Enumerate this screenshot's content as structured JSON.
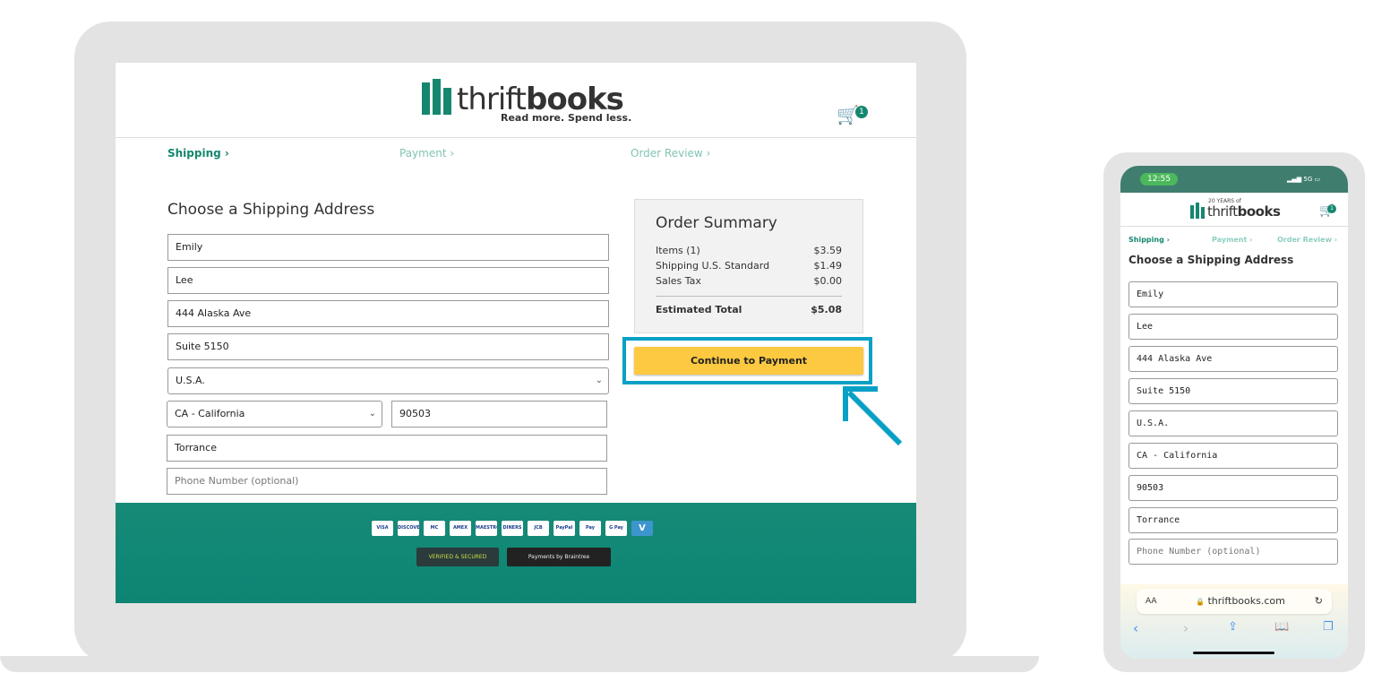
{
  "desktop": {
    "logo": {
      "word_light": "thrift",
      "word_bold": "books",
      "tagline": "Read more. Spend less."
    },
    "cart": {
      "icon": "cart-icon",
      "count": "1"
    },
    "steps": [
      {
        "label": "Shipping ›",
        "active": true
      },
      {
        "label": "Payment ›",
        "active": false
      },
      {
        "label": "Order Review ›",
        "active": false
      }
    ],
    "form": {
      "title": "Choose a Shipping Address",
      "first_name": "Emily",
      "last_name": "Lee",
      "address1": "444 Alaska Ave",
      "address2": "Suite 5150",
      "country": "U.S.A.",
      "state": "CA - California",
      "zip": "90503",
      "city": "Torrance",
      "phone_placeholder": "Phone Number (optional)"
    },
    "summary": {
      "title": "Order Summary",
      "rows": [
        {
          "label": "Items (1)",
          "value": "$3.59"
        },
        {
          "label": "Shipping U.S. Standard",
          "value": "$1.49"
        },
        {
          "label": "Sales Tax",
          "value": "$0.00"
        }
      ],
      "total_label": "Estimated Total",
      "total_value": "$5.08"
    },
    "continue_button": "Continue to Payment",
    "payment_cards": [
      "VISA",
      "DISCOVER",
      "MC",
      "AMEX",
      "MAESTRO",
      "DINERS",
      "JCB",
      "PayPal",
      "Pay",
      "G Pay",
      "V"
    ],
    "seals": {
      "godaddy": "VERIFIED & SECURED",
      "braintree": "Payments by Braintree"
    },
    "highlight_color": "#09a0c6"
  },
  "mobile": {
    "time": "12:55",
    "signal": "5G",
    "logo": {
      "anniversary": "20 YEARS of",
      "word_light": "thrift",
      "word_bold": "books"
    },
    "cart_count": "1",
    "steps": [
      "Shipping ›",
      "Payment ›",
      "Order Review ›"
    ],
    "title": "Choose a Shipping Address",
    "fields": [
      "Emily",
      "Lee",
      "444 Alaska Ave",
      "Suite 5150",
      "U.S.A.",
      "CA - California",
      "90503",
      "Torrance"
    ],
    "phone_placeholder": "Phone Number (optional)",
    "browser": {
      "aa": "AA",
      "url": "thriftbooks.com"
    }
  }
}
